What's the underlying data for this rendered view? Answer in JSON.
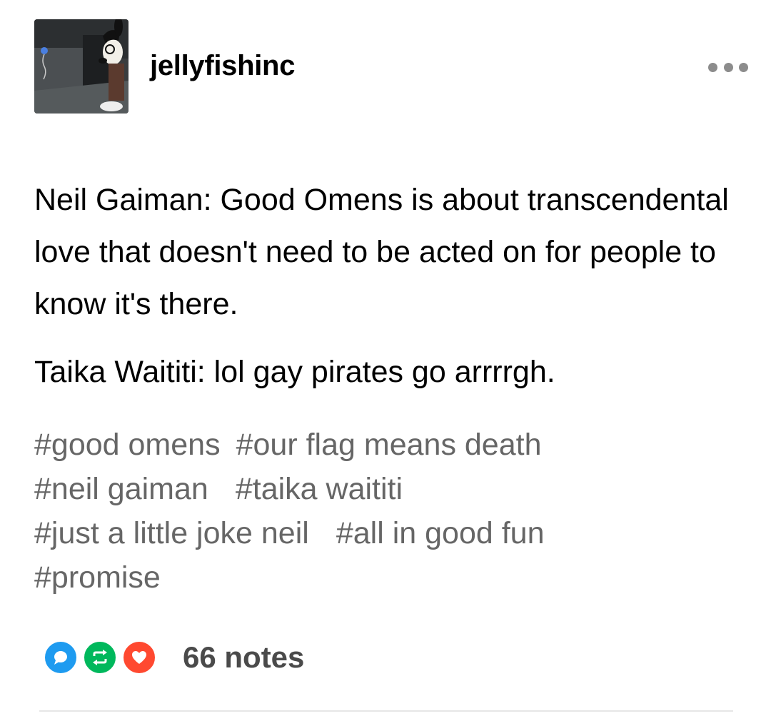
{
  "post": {
    "username": "jellyfishinc",
    "avatar_icon": "cartoon-avatar-icon",
    "menu_icon": "more-options-icon",
    "body": [
      "Neil Gaiman: Good Omens is about transcendental love that doesn't need to be acted on for people to know it's there.",
      "Taika Waititi: lol gay pirates go arrrrgh."
    ],
    "tags": [
      [
        "#good omens",
        "#our flag means death"
      ],
      [
        "#neil gaiman",
        "#taika waititi"
      ],
      [
        "#just a little joke neil",
        "#all in good fun"
      ],
      [
        "#promise"
      ]
    ],
    "notes_label": "66 notes",
    "note_icons": [
      {
        "name": "reply-icon",
        "color": "#1e9bf0"
      },
      {
        "name": "reblog-icon",
        "color": "#00b85c"
      },
      {
        "name": "like-icon",
        "color": "#ff4930"
      }
    ]
  }
}
